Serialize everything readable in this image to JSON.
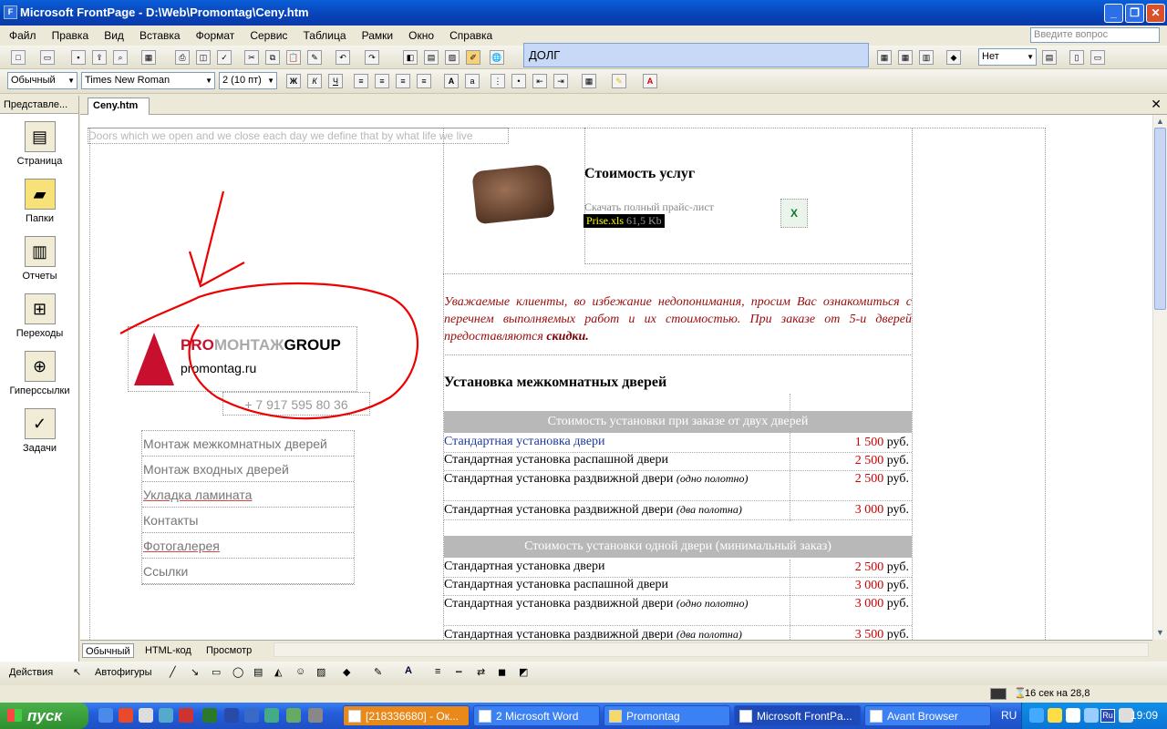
{
  "window": {
    "title": "Microsoft FrontPage - D:\\Web\\Promontag\\Ceny.htm"
  },
  "menu": [
    "Файл",
    "Правка",
    "Вид",
    "Вставка",
    "Формат",
    "Сервис",
    "Таблица",
    "Рамки",
    "Окно",
    "Справка"
  ],
  "ask_placeholder": "Введите вопрос",
  "autocomplete_text": "ДОЛГ",
  "format": {
    "style": "Обычный",
    "font": "Times New Roman",
    "size": "2 (10 пт)",
    "border_value": "Нет"
  },
  "views_panel": {
    "title": "Представле...",
    "items": [
      "Страница",
      "Папки",
      "Отчеты",
      "Переходы",
      "Гиперссылки",
      "Задачи"
    ]
  },
  "document_tab": "Ceny.htm",
  "page": {
    "motto": "Doors which we open and we close each day we define that by what life we live",
    "heading": "Стоимость услуг",
    "download_text": "Скачать полный прайс-лист",
    "file_name": "Prise.xls",
    "file_size": "61,5 Kb",
    "intro": "Уважаемые клиенты, во избежание недопонимания, просим Вас ознакомиться с перечнем выполняемых работ и их стоимостью. При заказе от 5-и дверей предоставляются",
    "intro_bold": "скидки.",
    "section_title": "Установка межкомнатных дверей",
    "band1": "Стоимость установки при заказе от двух дверей",
    "band2": "Стоимость установки одной двери (минимальный заказ)",
    "currency": "руб.",
    "rows1": [
      {
        "desc": "Стандартная установка двери",
        "note": "",
        "price": "1 500"
      },
      {
        "desc": "Стандартная установка распашной двери",
        "note": "",
        "price": "2 500"
      },
      {
        "desc": "Стандартная установка раздвижной двери",
        "note": "(одно полотно)",
        "price": "2 500"
      },
      {
        "desc": "Стандартная установка раздвижной двери",
        "note": "(два полотна)",
        "price": "3 000"
      }
    ],
    "rows2": [
      {
        "desc": "Стандартная установка двери",
        "note": "",
        "price": "2 500"
      },
      {
        "desc": "Стандартная установка распашной двери",
        "note": "",
        "price": "3 000"
      },
      {
        "desc": "Стандартная установка раздвижной двери",
        "note": "(одно полотно)",
        "price": "3 000"
      },
      {
        "desc": "Стандартная установка раздвижной двери",
        "note": "(два полотна)",
        "price": "3 500"
      }
    ],
    "logo": {
      "pro": "PRO",
      "montazh": "МОНТАЖ",
      "group": "GROUP",
      "site": "promontag.ru"
    },
    "phone": "+ 7 917 595 80 36",
    "nav": [
      "Монтаж межкомнатных дверей",
      "Монтаж входных дверей",
      "Укладка ламината",
      "Контакты",
      "Фотогалерея",
      "Ссылки"
    ]
  },
  "view_tabs": [
    "Обычный",
    "HTML-код",
    "Просмотр"
  ],
  "drawing": {
    "actions": "Действия",
    "autoshapes": "Автофигуры"
  },
  "status": {
    "load_time": "16 сек на 28,8"
  },
  "taskbar": {
    "start": "пуск",
    "tasks": [
      "[218336680] - Ок...",
      "2 Microsoft Word",
      "Promontag",
      "Microsoft FrontPa...",
      "Avant Browser"
    ],
    "lang": "RU",
    "tray_lang": "Ru",
    "clock": "19:09"
  }
}
